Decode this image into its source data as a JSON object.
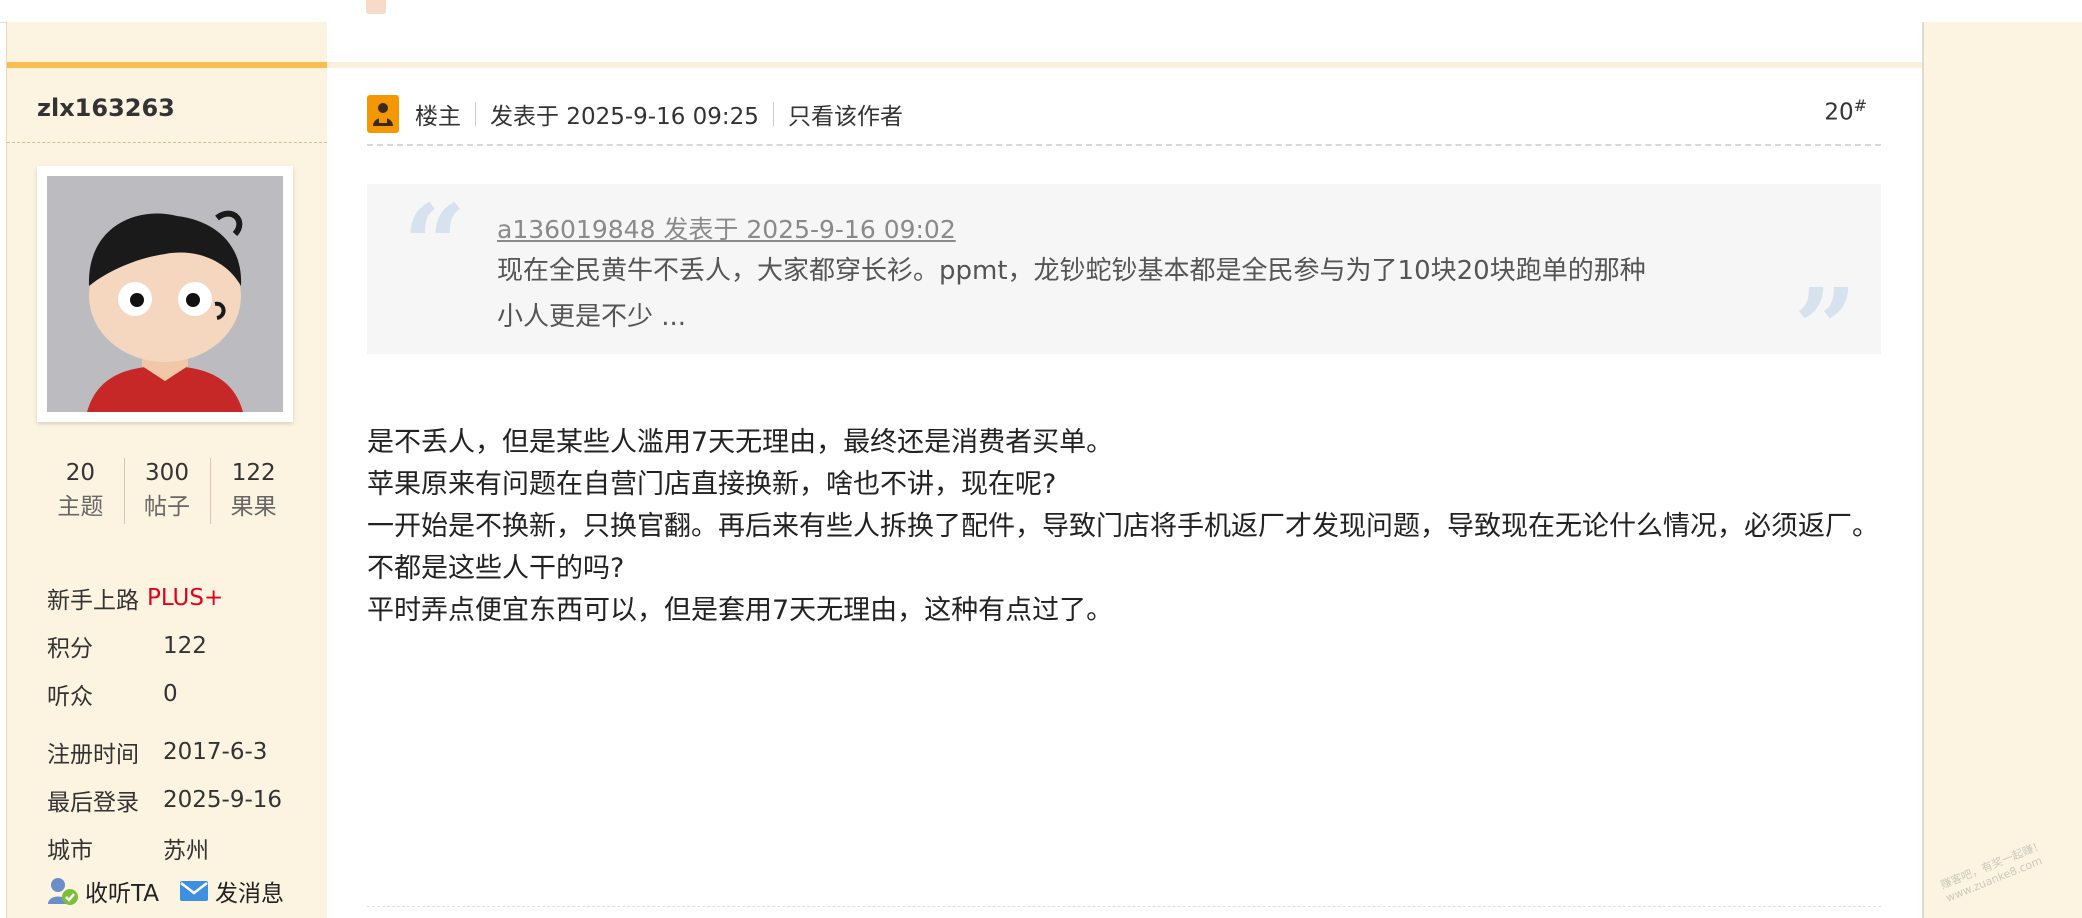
{
  "author": {
    "username": "zlx163263",
    "stats": [
      {
        "value": "20",
        "label": "主题"
      },
      {
        "value": "300",
        "label": "帖子"
      },
      {
        "value": "122",
        "label": "果果"
      }
    ],
    "rank_label": "新手上路",
    "rank_badge": "PLUS+",
    "info": {
      "points_label": "积分",
      "points_value": "122",
      "listeners_label": "听众",
      "listeners_value": "0",
      "reg_label": "注册时间",
      "reg_value": "2017-6-3",
      "login_label": "最后登录",
      "login_value": "2025-9-16",
      "city_label": "城市",
      "city_value": "苏州"
    },
    "actions": {
      "follow": "收听TA",
      "message": "发消息"
    }
  },
  "post": {
    "role": "楼主",
    "posted_at": "发表于 2025-9-16 09:25",
    "only_author": "只看该作者",
    "floor": "20",
    "floor_mark": "#",
    "quote": {
      "ref": "a136019848 发表于 2025-9-16 09:02",
      "line1": "现在全民黄牛不丢人，大家都穿长衫。ppmt，龙钞蛇钞基本都是全民参与为了10块20块跑单的那种",
      "line2": "小人更是不少 ..."
    },
    "body": [
      "是不丢人，但是某些人滥用7天无理由，最终还是消费者买单。",
      "苹果原来有问题在自营门店直接换新，啥也不讲，现在呢?",
      "一开始是不换新，只换官翻。再后来有些人拆换了配件，导致门店将手机返厂才发现问题，导致现在无论什么情况，必须返厂。",
      "不都是这些人干的吗?",
      "平时弄点便宜东西可以，但是套用7天无理由，这种有点过了。"
    ]
  },
  "watermark": {
    "line1": "赚客吧，有奖一起赚！",
    "line2": "www.zuanke8.com"
  },
  "colors": {
    "sidebar_bg": "#fcf4e0",
    "accent_orange": "#f9bd52",
    "rank_red": "#e3001b",
    "role_icon": "#f39800"
  }
}
